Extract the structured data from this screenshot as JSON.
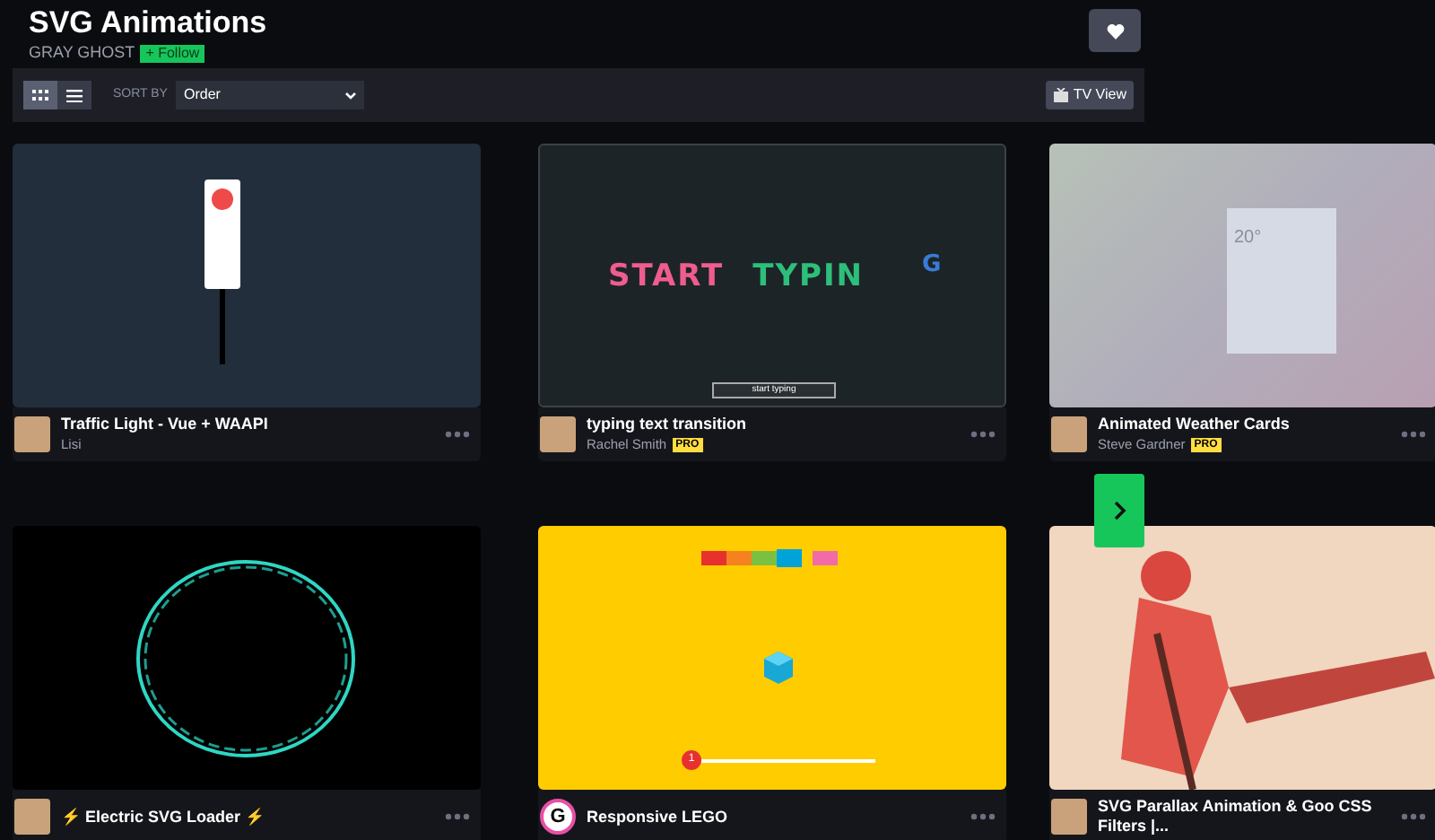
{
  "header": {
    "title": "SVG Animations",
    "owner": "GRAY GHOST",
    "follow_label": "+ Follow"
  },
  "toolbar": {
    "views": [
      {
        "kind": "grid",
        "selected": true
      },
      {
        "kind": "list",
        "selected": false
      }
    ],
    "sort_label": "SORT BY",
    "sort_value": "Order",
    "tv_button": "TV View"
  },
  "cards": [
    {
      "title": "Traffic Light - Vue + WAAPI",
      "author": "Lisi",
      "preview": {
        "kind": "traffic"
      }
    },
    {
      "title": "typing text transition",
      "author": "Rachel Smith",
      "pro_label": "PRO",
      "preview": {
        "kind": "typing",
        "words": [
          "START",
          "TYPIN",
          "G"
        ],
        "button": "start typing"
      }
    },
    {
      "title": "Animated Weather Cards",
      "author": "Steve Gardner",
      "pro_label": "PRO",
      "preview": {
        "kind": "weather",
        "temp": "20°"
      }
    },
    {
      "title": "⚡ Electric SVG Loader ⚡",
      "preview": {
        "kind": "ring"
      }
    },
    {
      "title": "Responsive LEGO",
      "avatar_letter": "G",
      "preview": {
        "kind": "lego",
        "step": "1",
        "level": 0.0
      }
    },
    {
      "title": "SVG Parallax Animation & Goo CSS Filters |...",
      "preview": {
        "kind": "parallax"
      }
    }
  ]
}
